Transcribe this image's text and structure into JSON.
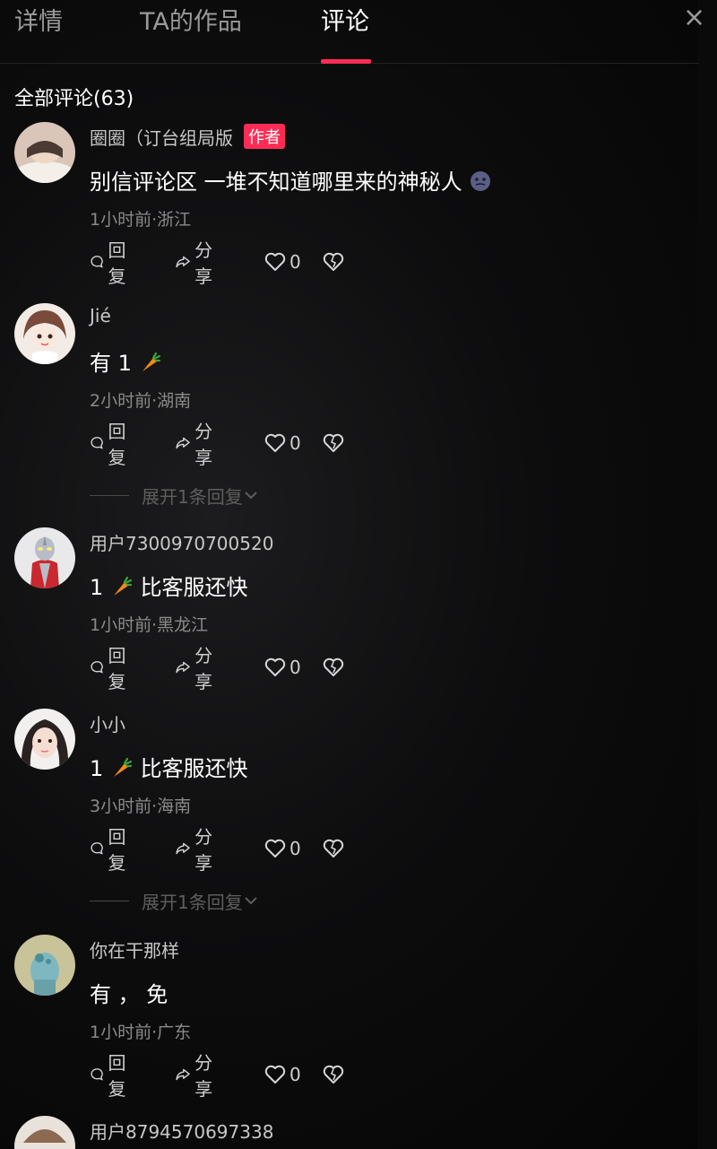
{
  "tabs": [
    "详情",
    "TA的作品",
    "评论"
  ],
  "close_label": "×",
  "comments_header": "全部评论(63)",
  "actions": {
    "reply": "回复",
    "share": "分享"
  },
  "author_badge": "作者",
  "expand_label": "展开1条回复",
  "comments": [
    {
      "user": "圈圈（订台组局版",
      "text": "别信评论区 一堆不知道哪里来的神秘人",
      "meta": "1小时前·浙江",
      "likes": "0",
      "is_author": true
    },
    {
      "user": "Jié",
      "text": "有 1",
      "meta": "2小时前·湖南",
      "likes": "0"
    },
    {
      "user": "用户7300970700520",
      "text_prefix": "1",
      "text": "比客服还快",
      "meta": "1小时前·黑龙江",
      "likes": "0"
    },
    {
      "user": "小小",
      "text_prefix": "1",
      "text": "比客服还快",
      "meta": "3小时前·海南",
      "likes": "0"
    },
    {
      "user": "你在干那样",
      "text": "有 ， 免",
      "meta": "1小时前·广东",
      "likes": "0"
    },
    {
      "user": "用户8794570697338"
    }
  ],
  "colors": {
    "accent": "#fe2c55",
    "background": "#050505",
    "muted_text": "#8a8a8a"
  }
}
